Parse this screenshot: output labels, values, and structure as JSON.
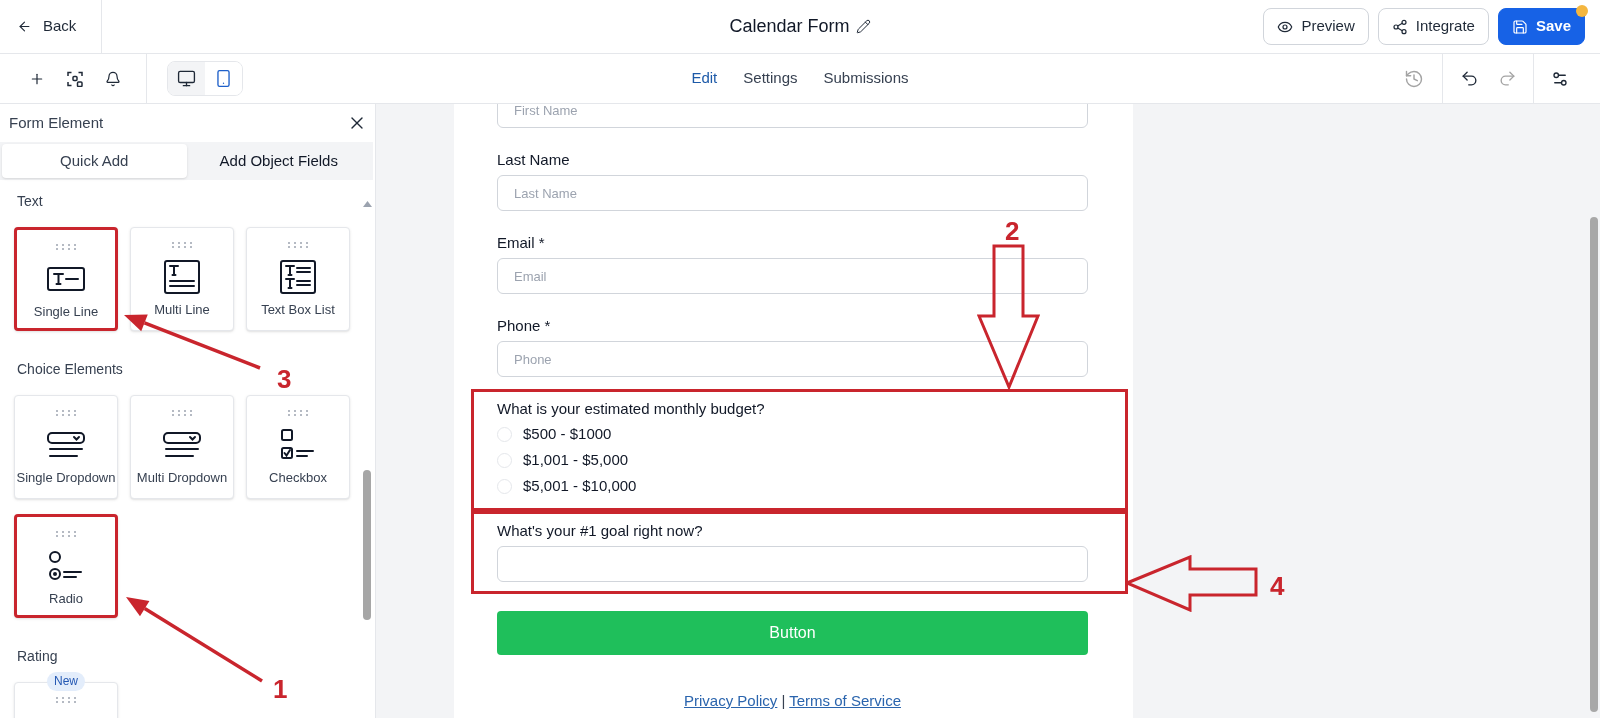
{
  "header": {
    "back_label": "Back",
    "title": "Calendar Form",
    "buttons": [
      {
        "kind": "preview",
        "label": "Preview",
        "primary": false,
        "dot": false
      },
      {
        "kind": "integrate",
        "label": "Integrate",
        "primary": false,
        "dot": false
      },
      {
        "kind": "save",
        "label": "Save",
        "primary": true,
        "dot": true
      }
    ]
  },
  "toolbar": {
    "devices": [
      {
        "kind": "desktop",
        "selected": false
      },
      {
        "kind": "mobile",
        "selected": true
      }
    ],
    "tabs": [
      {
        "label": "Edit",
        "selected": true
      },
      {
        "label": "Settings",
        "selected": false
      },
      {
        "label": "Submissions",
        "selected": false
      }
    ],
    "history": {
      "disabled": true
    },
    "undo": {
      "disabled": false
    },
    "redo": {
      "disabled": true
    }
  },
  "sidebar": {
    "title": "Form Element",
    "tabs": [
      {
        "label": "Quick Add",
        "selected": true
      },
      {
        "label": "Add Object Fields",
        "selected": false
      }
    ],
    "sections": [
      {
        "title": "Text",
        "items": [
          {
            "kind": "single_line",
            "label": "Single Line",
            "highlighted": true
          },
          {
            "kind": "multi_line",
            "label": "Multi Line",
            "highlighted": false
          },
          {
            "kind": "text_box_list",
            "label": "Text Box List",
            "highlighted": false
          }
        ]
      },
      {
        "title": "Choice Elements",
        "items": [
          {
            "kind": "single_dropdown",
            "label": "Single Dropdown",
            "highlighted": false
          },
          {
            "kind": "multi_dropdown",
            "label": "Multi Dropdown",
            "highlighted": false
          },
          {
            "kind": "checkbox",
            "label": "Checkbox",
            "highlighted": false
          },
          {
            "kind": "radio",
            "label": "Radio",
            "highlighted": true
          }
        ]
      },
      {
        "title": "Rating",
        "items": [
          {
            "kind": "rating",
            "badge": "New",
            "highlighted": false
          }
        ]
      }
    ]
  },
  "form": {
    "fields": [
      {
        "kind": "text",
        "placeholder": "First Name",
        "highlighted": false
      },
      {
        "kind": "text",
        "label": "Last Name",
        "placeholder": "Last Name",
        "highlighted": false
      },
      {
        "kind": "text",
        "label": "Email *",
        "placeholder": "Email",
        "highlighted": false
      },
      {
        "kind": "text",
        "label": "Phone *",
        "placeholder": "Phone",
        "highlighted": false
      },
      {
        "kind": "radio",
        "label": "What is your estimated monthly budget?",
        "highlighted": true,
        "options": [
          {
            "label": "$500 - $1000",
            "selected": false
          },
          {
            "label": "$1,001 - $5,000",
            "selected": false
          },
          {
            "label": "$5,001 - $10,000",
            "selected": false
          }
        ]
      },
      {
        "kind": "text",
        "label": "What's your #1 goal right now?",
        "highlighted": true
      }
    ],
    "submit_label": "Button",
    "links": [
      {
        "label": "Privacy Policy"
      },
      {
        "label": "Terms of Service"
      }
    ],
    "link_separator": "|"
  },
  "annotations": [
    {
      "number": "2",
      "kind": "hollow_down"
    },
    {
      "number": "3",
      "kind": "line"
    },
    {
      "number": "4",
      "kind": "hollow_left"
    },
    {
      "number": "1",
      "kind": "line"
    }
  ]
}
